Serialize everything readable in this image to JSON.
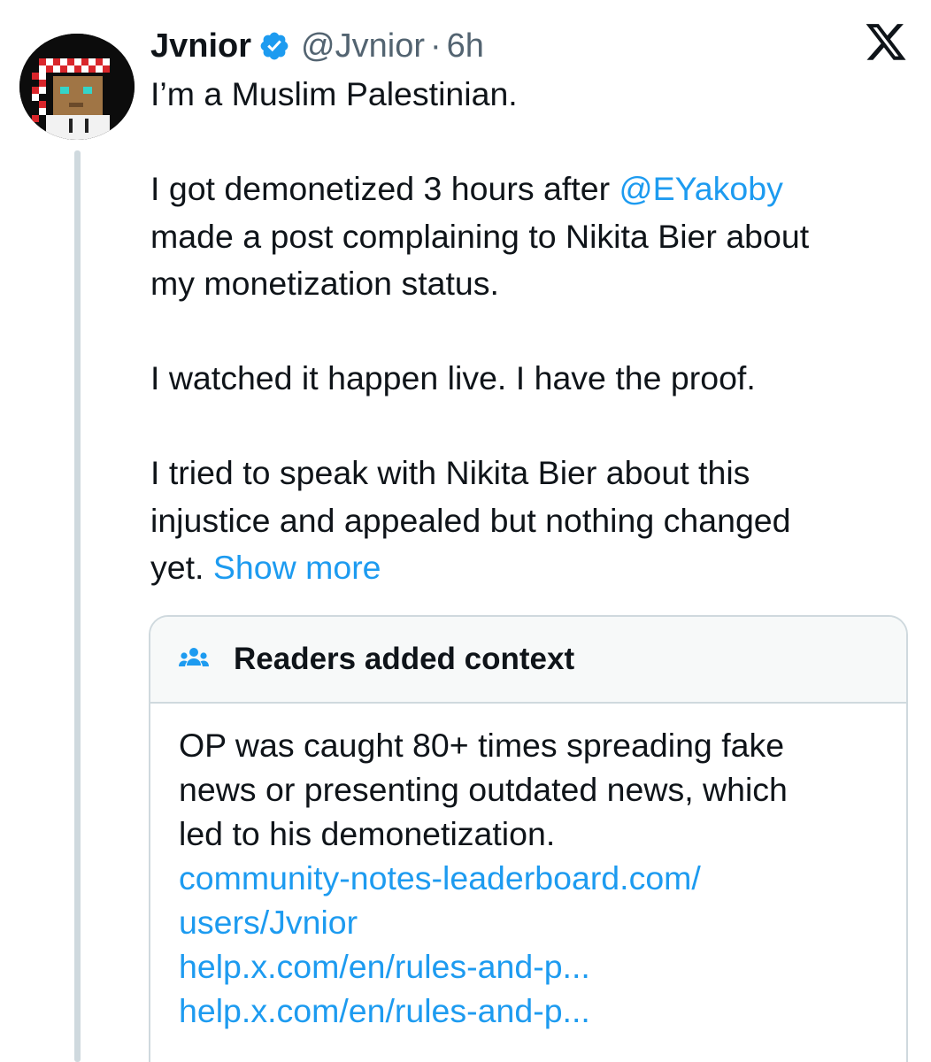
{
  "tweet": {
    "author_name": "Jvnior",
    "author_handle": "@Jvnior",
    "separator": "·",
    "timestamp": "6h",
    "verified": true,
    "paragraphs": {
      "p1": "I’m a Muslim Palestinian.",
      "p2_before": "I got demonetized 3 hours after ",
      "p2_mention": "@EYakoby",
      "p2_line2": "made a post complaining to Nikita Bier about",
      "p2_line3": "my monetization status.",
      "p3": "I watched it happen live. I have the proof.",
      "p4_line1": "I tried to speak with Nikita Bier about this",
      "p4_line2": "injustice and appealed but nothing changed",
      "p4_end": "yet. ",
      "show_more": "Show more"
    }
  },
  "community_note": {
    "title": "Readers added context",
    "icon": "people-group-icon",
    "lines": {
      "l1": "OP was caught 80+ times spreading fake",
      "l2": "news or presenting outdated news, which",
      "l3": "led to his demonetization."
    },
    "links": [
      "community-notes-leaderboard.com/",
      "users/Jvnior",
      "help.x.com/en/rules-and-p...",
      "help.x.com/en/rules-and-p..."
    ]
  },
  "colors": {
    "link": "#1d9bf0",
    "text": "#0f1419",
    "secondary": "#536471",
    "border": "#cfd9de"
  }
}
